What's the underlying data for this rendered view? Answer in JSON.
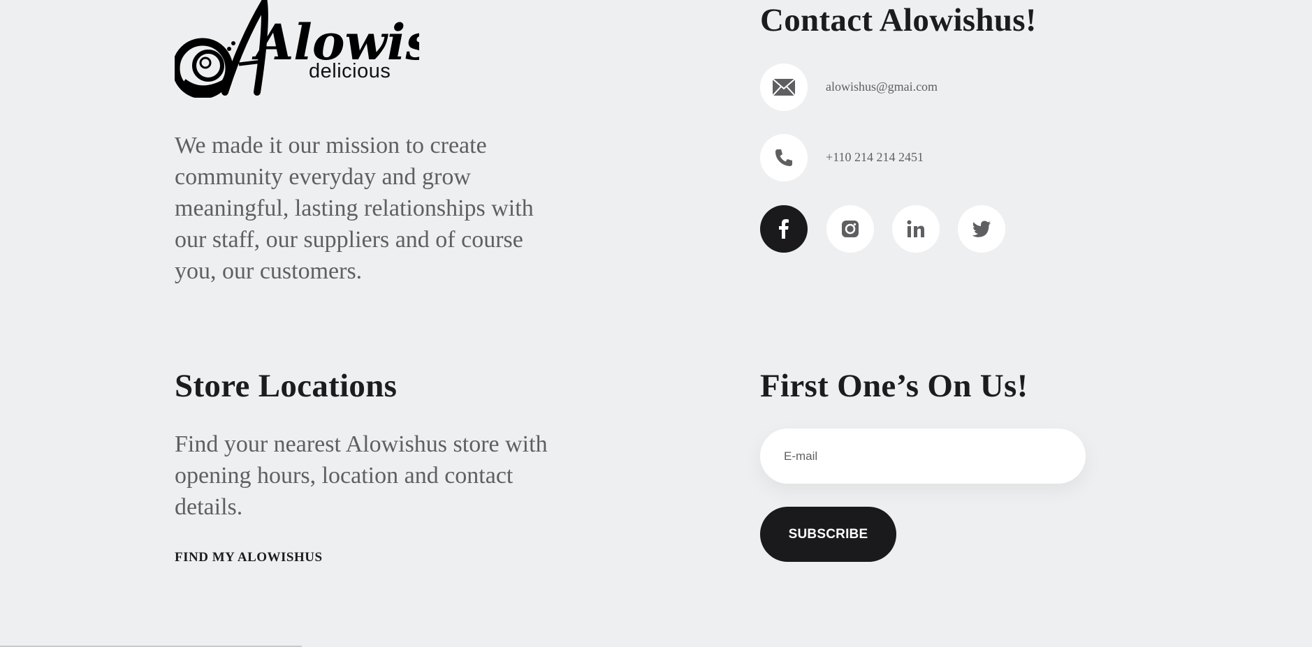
{
  "brand": {
    "logo_word": "Alowishus",
    "logo_sub": "delicious"
  },
  "about": {
    "mission": "We made it our mission to create community everyday and grow meaningful, lasting relationships with our staff, our suppliers and of course you, our customers."
  },
  "contact": {
    "heading": "Contact Alowishus!",
    "email": "alowishus@gmai.com",
    "phone": "+110 214 214 2451",
    "email_icon": "envelope-icon",
    "phone_icon": "phone-icon",
    "social": [
      {
        "name": "facebook",
        "icon": "facebook-icon",
        "active": true
      },
      {
        "name": "instagram",
        "icon": "instagram-icon",
        "active": false
      },
      {
        "name": "linkedin",
        "icon": "linkedin-icon",
        "active": false
      },
      {
        "name": "twitter",
        "icon": "twitter-icon",
        "active": false
      }
    ]
  },
  "stores": {
    "heading": "Store Locations",
    "text": "Find your nearest Alowishus store with opening hours, location and contact details.",
    "link_label": "FIND MY ALOWISHUS"
  },
  "newsletter": {
    "heading": "First One’s On Us!",
    "email_placeholder": "E-mail",
    "email_value": "",
    "button_label": "SUBSCRIBE"
  },
  "colors": {
    "background": "#eeeff1",
    "dark": "#1a1a1c",
    "muted_text": "#5f5f62",
    "white": "#ffffff"
  }
}
